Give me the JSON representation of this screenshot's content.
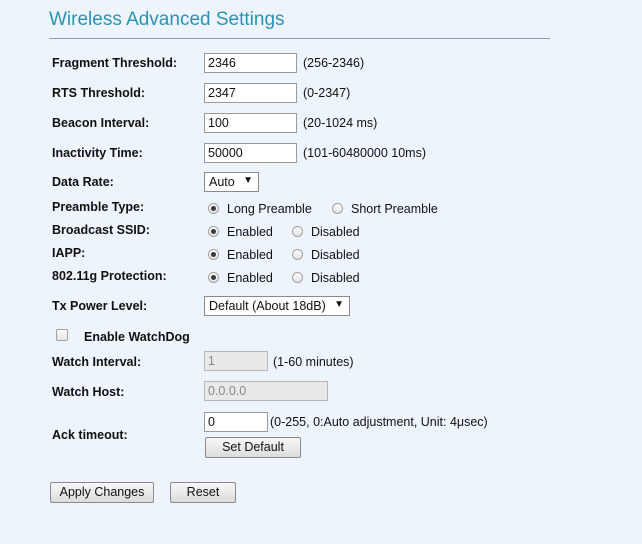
{
  "page": {
    "title": "Wireless Advanced Settings"
  },
  "fields": {
    "fragment": {
      "label": "Fragment Threshold:",
      "value": "2346",
      "hint": "(256-2346)"
    },
    "rts": {
      "label": "RTS Threshold:",
      "value": "2347",
      "hint": "(0-2347)"
    },
    "beacon": {
      "label": "Beacon Interval:",
      "value": "100",
      "hint": "(20-1024 ms)"
    },
    "inactivity": {
      "label": "Inactivity Time:",
      "value": "50000",
      "hint": "(101-60480000 10ms)"
    },
    "data_rate": {
      "label": "Data Rate:",
      "selected": "Auto"
    },
    "preamble": {
      "label": "Preamble Type:",
      "opt1": "Long Preamble",
      "opt2": "Short Preamble",
      "selected": "Long Preamble"
    },
    "broadcast_ssid": {
      "label": "Broadcast SSID:",
      "opt1": "Enabled",
      "opt2": "Disabled",
      "selected": "Enabled"
    },
    "iapp": {
      "label": "IAPP:",
      "opt1": "Enabled",
      "opt2": "Disabled",
      "selected": "Enabled"
    },
    "protection": {
      "label": "802.11g Protection:",
      "opt1": "Enabled",
      "opt2": "Disabled",
      "selected": "Enabled"
    },
    "tx_power": {
      "label": "Tx Power Level:",
      "selected": "Default (About 18dB)"
    },
    "watchdog": {
      "label": "Enable WatchDog",
      "checked": false
    },
    "watch_interval": {
      "label": "Watch Interval:",
      "value": "1",
      "hint": "(1-60 minutes)"
    },
    "watch_host": {
      "label": "Watch Host:",
      "value": "0.0.0.0"
    },
    "ack_timeout": {
      "label": "Ack timeout:",
      "value": "0",
      "hint": "(0-255, 0:Auto adjustment, Unit: 4μsec)",
      "button": "Set Default"
    }
  },
  "buttons": {
    "apply": "Apply Changes",
    "reset": "Reset"
  },
  "colors": {
    "title": "#2a93b5",
    "background": "#eef4fb"
  }
}
